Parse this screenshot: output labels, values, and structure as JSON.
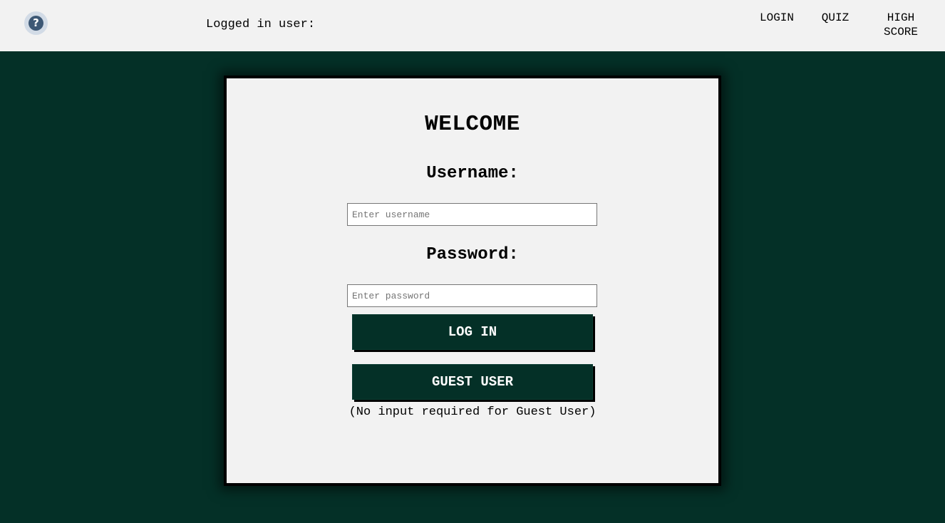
{
  "header": {
    "help_icon": "question-mark-icon",
    "logged_in_label": "Logged in user:",
    "logged_in_user": "",
    "nav": {
      "login": "LOGIN",
      "quiz": "QUIZ",
      "high_score_line1": "HIGH",
      "high_score_line2": "SCORE"
    }
  },
  "login_card": {
    "title": "WELCOME",
    "username_label": "Username:",
    "username_placeholder": "Enter username",
    "username_value": "",
    "password_label": "Password:",
    "password_placeholder": "Enter password",
    "password_value": "",
    "login_button": "LOG IN",
    "guest_button": "GUEST USER",
    "guest_note": "(No input required for Guest User)"
  },
  "colors": {
    "background": "#043027",
    "topbar": "#f2f2f2",
    "card": "#f2f2f2",
    "button": "#043027",
    "help_icon": "#3d5875"
  }
}
